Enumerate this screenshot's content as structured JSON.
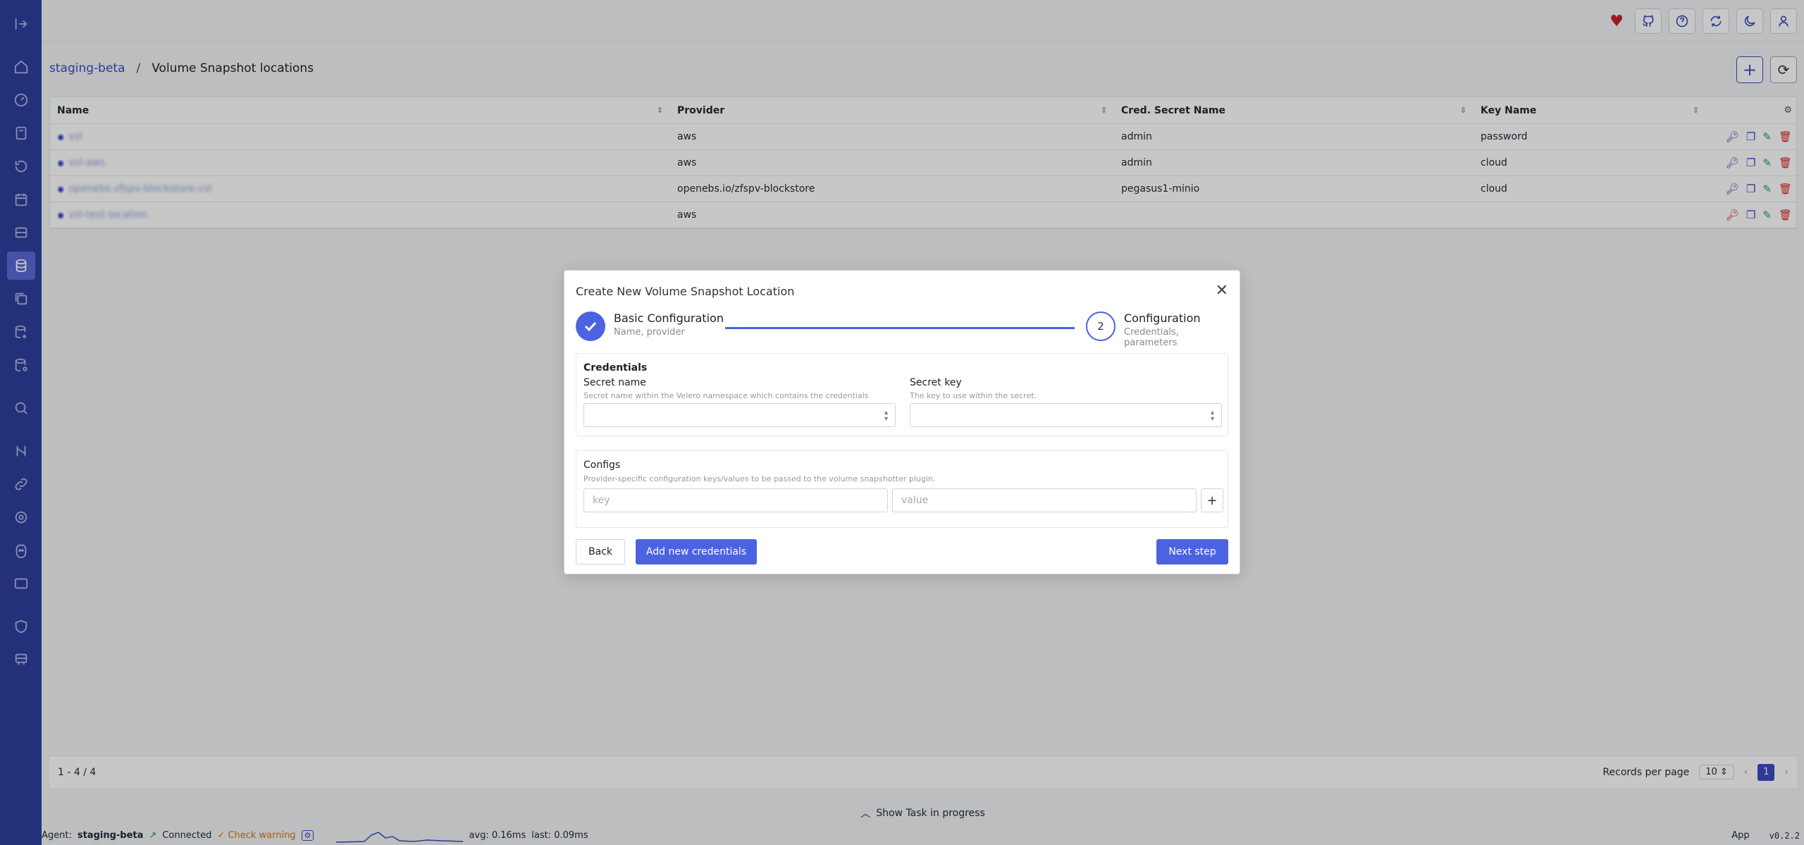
{
  "breadcrumb": {
    "cluster": "staging-beta",
    "separator": "/",
    "current": "Volume Snapshot locations"
  },
  "table": {
    "headers": [
      "Name",
      "Provider",
      "Cred. Secret Name",
      "Key Name"
    ],
    "rows": [
      {
        "name": "vsl",
        "provider": "aws",
        "secret": "admin",
        "key": "password"
      },
      {
        "name": "vsl-aws",
        "provider": "aws",
        "secret": "admin",
        "key": "cloud"
      },
      {
        "name": "openebs-zfspv-blockstore-vsl",
        "provider": "openebs.io/zfspv-blockstore",
        "secret": "pegasus1-minio",
        "key": "cloud"
      },
      {
        "name": "vsl-test-location",
        "provider": "aws",
        "secret": "",
        "key": ""
      }
    ]
  },
  "footer": {
    "range": "1 - 4 / 4",
    "records_per_page_label": "Records per page",
    "records_per_page_value": "10",
    "current_page": "1"
  },
  "task_bar": {
    "label": "Show Task in progress"
  },
  "status": {
    "agent_label": "Agent:",
    "agent_name": "staging-beta",
    "connected": "Connected",
    "check_warning": "Check warning",
    "avg": "avg: 0.16ms",
    "last": "last: 0.09ms",
    "app": "App",
    "version": "v0.2.2"
  },
  "modal": {
    "title": "Create New Volume Snapshot Location",
    "step1_title": "Basic Configuration",
    "step1_sub": "Name, provider",
    "step2_number": "2",
    "step2_title": "Configuration",
    "step2_sub": "Credentials, parameters",
    "credentials_title": "Credentials",
    "secret_name_label": "Secret name",
    "secret_name_help": "Secret name within the Velero namespace which contains the credentials",
    "secret_key_label": "Secret key",
    "secret_key_help": "The key to use within the secret.",
    "configs_title": "Configs",
    "configs_help": "Provider-specific configuration keys/values to be passed to the volume snapshotter plugin.",
    "key_placeholder": "key",
    "value_placeholder": "value",
    "back_label": "Back",
    "add_credentials_label": "Add new credentials",
    "next_label": "Next step"
  },
  "colors": {
    "primary": "#4b63e0",
    "sidebar": "#2e3f9e",
    "success": "#16a34a",
    "danger": "#dc2626"
  }
}
